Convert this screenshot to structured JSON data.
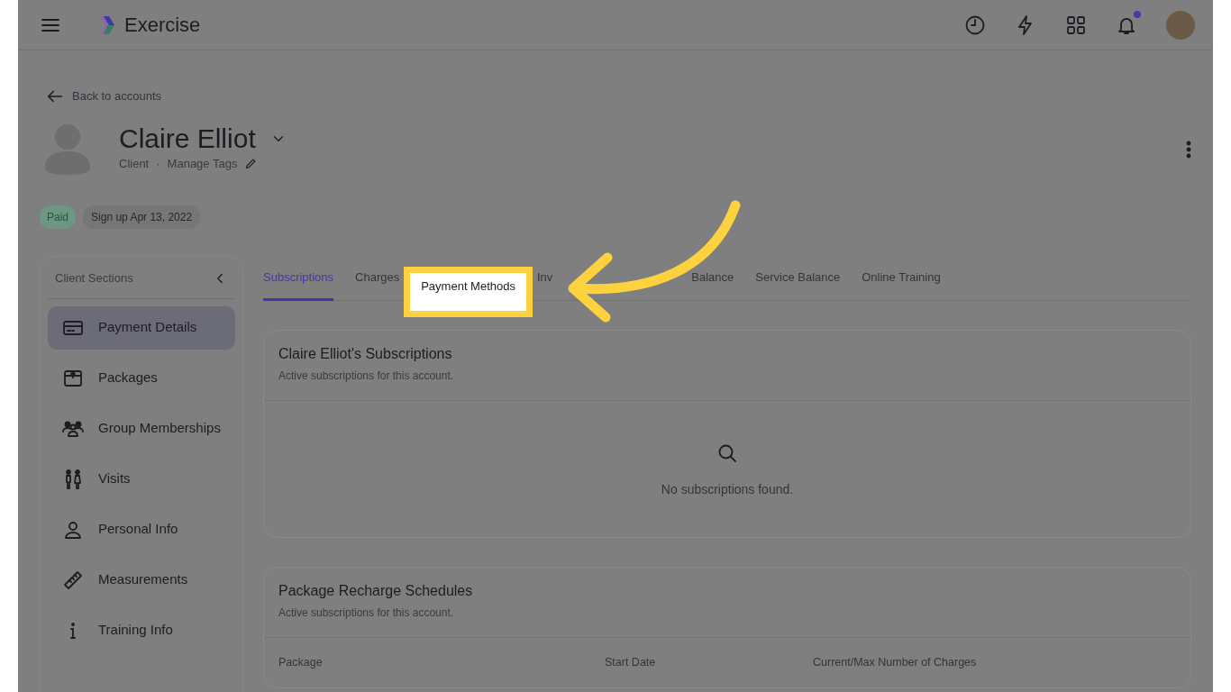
{
  "app": {
    "title": "Exercise",
    "notifications_unread": true
  },
  "back_link": "Back to accounts",
  "profile": {
    "name": "Claire Elliot",
    "role": "Client",
    "separator": "·",
    "tags_link": "Manage Tags"
  },
  "badges": [
    {
      "text": "Paid",
      "kind": "status"
    },
    {
      "text": "Sign up Apr 13, 2022",
      "kind": "info"
    }
  ],
  "sidebar": {
    "title": "Client Sections",
    "items": [
      {
        "label": "Payment Details",
        "selected": true
      },
      {
        "label": "Packages",
        "selected": false
      },
      {
        "label": "Group Memberships",
        "selected": false
      },
      {
        "label": "Visits",
        "selected": false
      },
      {
        "label": "Personal Info",
        "selected": false
      },
      {
        "label": "Measurements",
        "selected": false
      },
      {
        "label": "Training Info",
        "selected": false
      }
    ]
  },
  "tabs": [
    {
      "label": "Subscriptions",
      "selected": true,
      "highlighted": false
    },
    {
      "label": "Charges",
      "selected": false,
      "highlighted": false
    },
    {
      "label": "Payment Methods",
      "selected": false,
      "highlighted": true
    },
    {
      "label": "Inv",
      "selected": false,
      "highlighted": false
    },
    {
      "label": "Balance",
      "selected": false,
      "highlighted": false
    },
    {
      "label": "Service Balance",
      "selected": false,
      "highlighted": false
    },
    {
      "label": "Online Training",
      "selected": false,
      "highlighted": false
    }
  ],
  "cards": [
    {
      "kind": "empty",
      "title": "Claire Elliot's Subscriptions",
      "subtitle": "Active subscriptions for this account.",
      "empty_text": "No subscriptions found."
    },
    {
      "kind": "table",
      "title": "Package Recharge Schedules",
      "subtitle": "Active subscriptions for this account.",
      "columns": [
        "Package",
        "Start Date",
        "Current/Max Number of Charges"
      ]
    }
  ]
}
